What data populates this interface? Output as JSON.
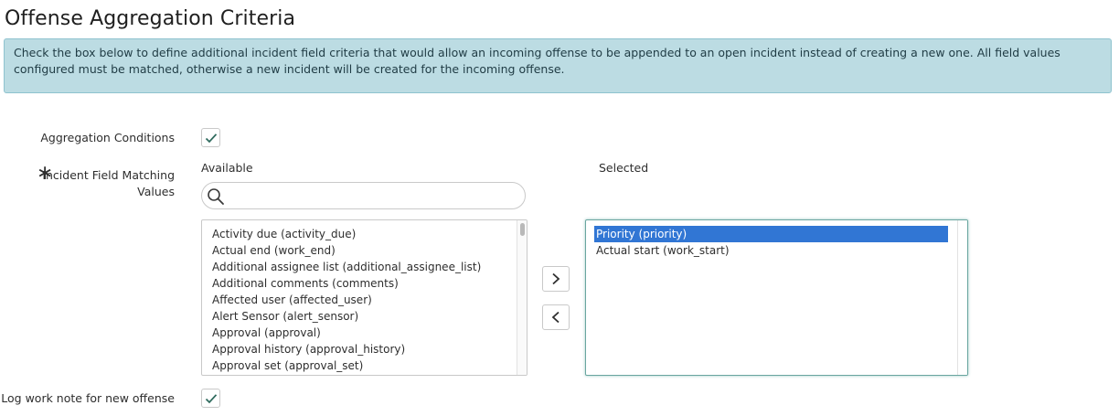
{
  "page": {
    "title": "Offense Aggregation Criteria",
    "info": "Check the box below to define additional incident field criteria that would allow an incoming offense to be appended to an open incident instead of creating a new one. All field values configured must be matched, otherwise a new incident will be created for the incoming offense."
  },
  "form": {
    "aggregation_conditions": {
      "label": "Aggregation Conditions",
      "checked": true
    },
    "incident_field_matching": {
      "label_line1": "Incident Field Matching",
      "label_line2": "Values",
      "required_mark": "∗",
      "available_header": "Available",
      "selected_header": "Selected",
      "search_value": "",
      "available": [
        "Activity due (activity_due)",
        "Actual end (work_end)",
        "Additional assignee list (additional_assignee_list)",
        "Additional comments (comments)",
        "Affected user (affected_user)",
        "Alert Sensor (alert_sensor)",
        "Approval (approval)",
        "Approval history (approval_history)",
        "Approval set (approval_set)"
      ],
      "selected": [
        "Priority (priority)",
        "Actual start (work_start)"
      ],
      "add_icon": "chevron-right-icon",
      "remove_icon": "chevron-left-icon"
    },
    "log_work_note": {
      "label": "Log work note for new offense",
      "checked": true
    }
  },
  "colors": {
    "info_bg": "#bcdce3",
    "selection": "#3176d4",
    "check": "#2f6b5e"
  }
}
